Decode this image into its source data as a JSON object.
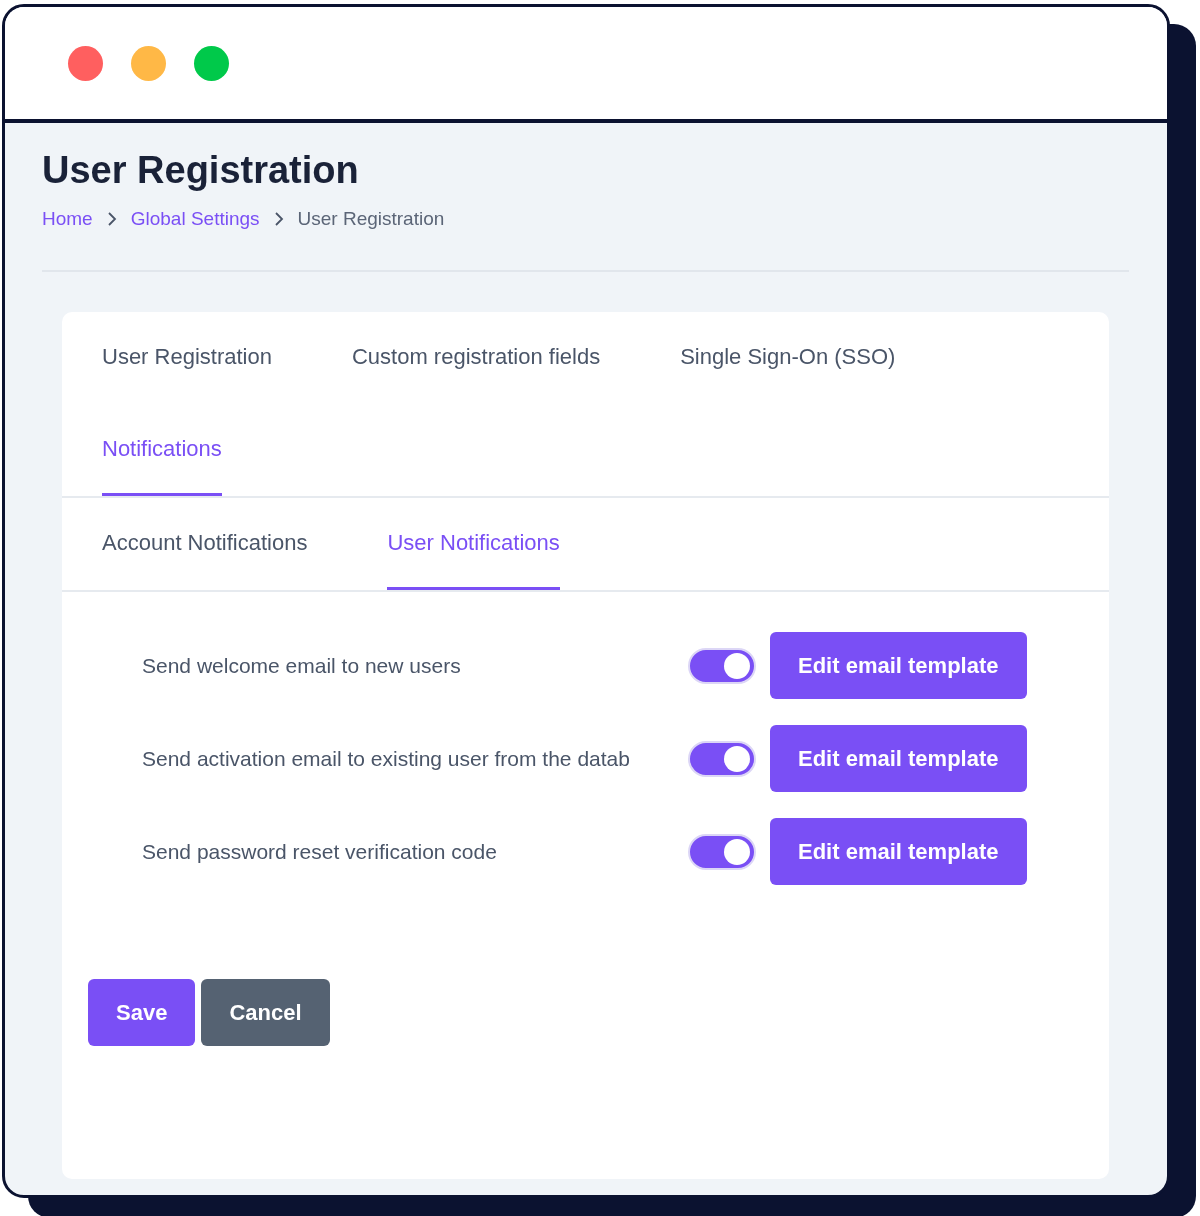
{
  "window": {
    "controls": [
      {
        "color": "#ff5f5f"
      },
      {
        "color": "#ffb846"
      },
      {
        "color": "#00c94a"
      }
    ]
  },
  "page": {
    "title": "User Registration"
  },
  "breadcrumbs": [
    {
      "label": "Home",
      "kind": "link"
    },
    {
      "label": "Global Settings",
      "kind": "link"
    },
    {
      "label": "User Registration",
      "kind": "current"
    }
  ],
  "tabs": [
    {
      "label": "User Registration",
      "selected": false
    },
    {
      "label": "Custom registration fields",
      "selected": false
    },
    {
      "label": "Single Sign-On (SSO)",
      "selected": false
    },
    {
      "label": "Notifications",
      "selected": true
    }
  ],
  "subtabs": [
    {
      "label": "Account Notifications",
      "selected": false
    },
    {
      "label": "User Notifications",
      "selected": true
    }
  ],
  "settings": [
    {
      "label": "Send welcome email to new users",
      "on": true,
      "button": "Edit email template"
    },
    {
      "label": "Send activation email to existing user from the datab",
      "on": true,
      "button": "Edit email template"
    },
    {
      "label": "Send password reset verification code",
      "on": true,
      "button": "Edit email template"
    }
  ],
  "actions": [
    {
      "label": "Save",
      "kind": "primary"
    },
    {
      "label": "Cancel",
      "kind": "secondary"
    }
  ]
}
